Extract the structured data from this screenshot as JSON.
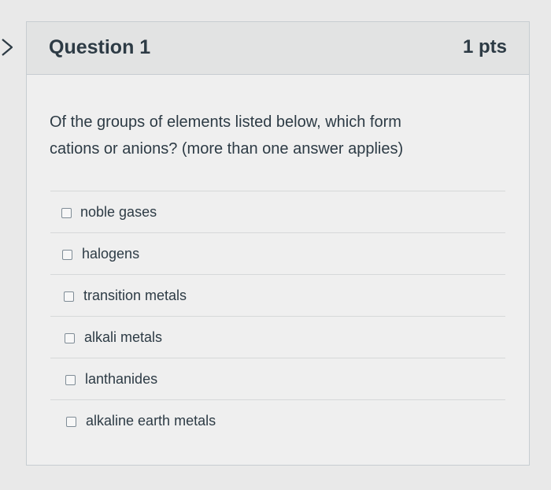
{
  "question": {
    "title": "Question 1",
    "points": "1 pts",
    "text_line1": "Of the groups of elements listed below, which form",
    "text_line2": "cations or anions? (more than one answer applies)"
  },
  "answers": [
    {
      "label": "noble gases",
      "checked": false
    },
    {
      "label": "halogens",
      "checked": false
    },
    {
      "label": "transition metals",
      "checked": false
    },
    {
      "label": "alkali metals",
      "checked": false
    },
    {
      "label": "lanthanides",
      "checked": false
    },
    {
      "label": "alkaline earth metals",
      "checked": false
    }
  ],
  "icons": {
    "nav": "chevron-right-icon"
  }
}
